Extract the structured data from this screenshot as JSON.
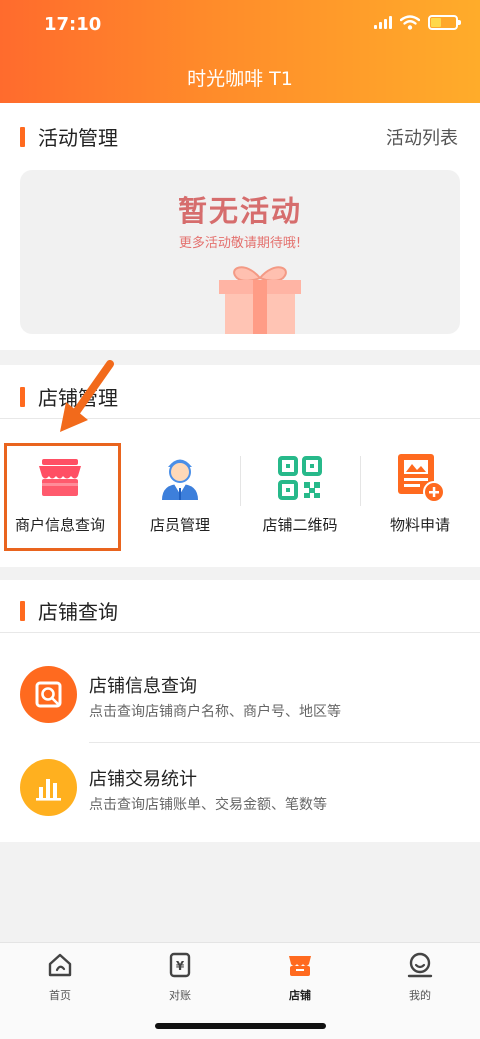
{
  "status_bar": {
    "time": "17:10"
  },
  "header": {
    "title": "时光咖啡 T1"
  },
  "activity": {
    "section_title": "活动管理",
    "list_link": "活动列表",
    "empty_title": "暂无活动",
    "empty_subtitle": "更多活动敬请期待哦!"
  },
  "store_management": {
    "section_title": "店铺管理",
    "items": [
      {
        "label": "商户信息查询",
        "icon": "storefront-icon"
      },
      {
        "label": "店员管理",
        "icon": "staff-icon"
      },
      {
        "label": "店铺二维码",
        "icon": "qr-code-icon"
      },
      {
        "label": "物料申请",
        "icon": "material-apply-icon"
      }
    ]
  },
  "store_query": {
    "section_title": "店铺查询",
    "rows": [
      {
        "title": "店铺信息查询",
        "desc": "点击查询店铺商户名称、商户号、地区等",
        "icon": "search-info-icon",
        "color": "#ff6a1f"
      },
      {
        "title": "店铺交易统计",
        "desc": "点击查询店铺账单、交易金额、笔数等",
        "icon": "bar-chart-icon",
        "color": "#ffb01f"
      }
    ]
  },
  "tabbar": {
    "tabs": [
      {
        "label": "首页",
        "icon": "home-icon"
      },
      {
        "label": "对账",
        "icon": "reconcile-icon"
      },
      {
        "label": "店铺",
        "icon": "store-icon",
        "active": true
      },
      {
        "label": "我的",
        "icon": "profile-icon"
      }
    ]
  },
  "colors": {
    "accent": "#ff6a1f",
    "highlight_border": "#e9641e"
  }
}
